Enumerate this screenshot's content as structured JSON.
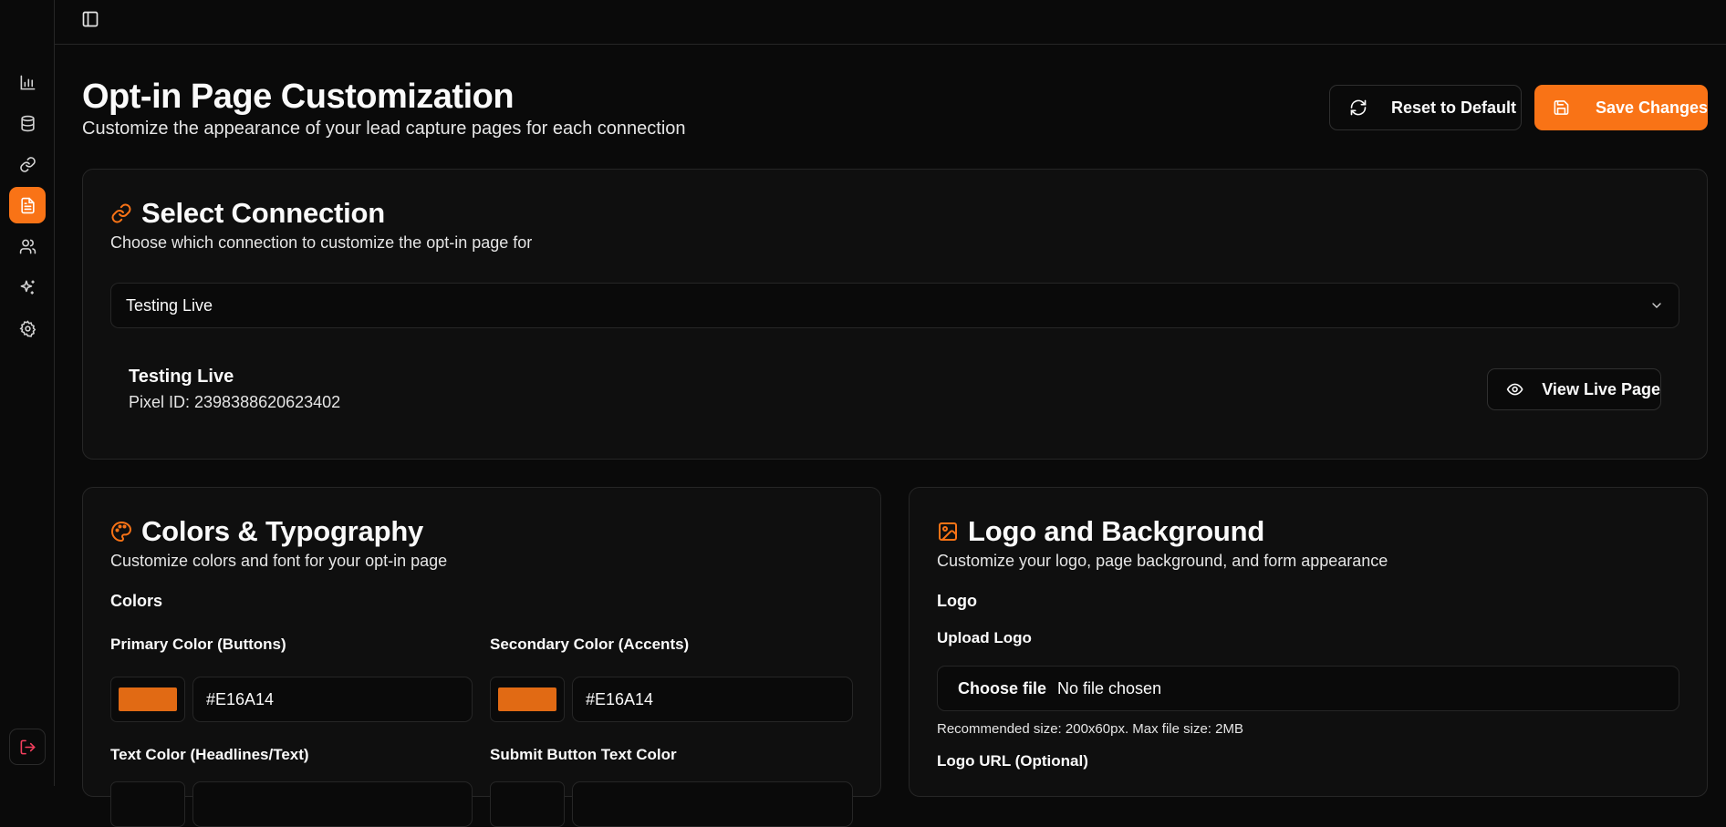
{
  "colors": {
    "accent": "#f97316",
    "background": "#0a0a0a",
    "card": "#0f0f0f",
    "border": "#262626",
    "logout": "#f43f5e"
  },
  "sidebar": {
    "items": [
      {
        "icon": "bar-chart-icon",
        "active": false
      },
      {
        "icon": "database-icon",
        "active": false
      },
      {
        "icon": "link-icon",
        "active": false
      },
      {
        "icon": "file-text-icon",
        "active": true
      },
      {
        "icon": "users-icon",
        "active": false
      },
      {
        "icon": "sparkles-icon",
        "active": false
      },
      {
        "icon": "gear-icon",
        "active": false
      }
    ],
    "logout_icon": "logout-icon"
  },
  "header": {
    "title": "Opt-in Page Customization",
    "subtitle": "Customize the appearance of your lead capture pages for each connection",
    "reset_label": "Reset to Default",
    "save_label": "Save Changes"
  },
  "select_connection": {
    "title": "Select Connection",
    "subtitle": "Choose which connection to customize the opt-in page for",
    "selected": "Testing Live",
    "connection_name": "Testing Live",
    "pixel_id": "Pixel ID: 2398388620623402",
    "view_live_label": "View Live Page"
  },
  "colors_typography": {
    "title": "Colors & Typography",
    "subtitle": "Customize colors and font for your opt-in page",
    "section_label": "Colors",
    "primary_label": "Primary Color (Buttons)",
    "primary_value": "#E16A14",
    "secondary_label": "Secondary Color (Accents)",
    "secondary_value": "#E16A14",
    "text_color_label": "Text Color (Headlines/Text)",
    "submit_text_label": "Submit Button Text Color"
  },
  "logo_background": {
    "title": "Logo and Background",
    "subtitle": "Customize your logo, page background, and form appearance",
    "section_label": "Logo",
    "upload_label": "Upload Logo",
    "choose_file": "Choose file",
    "no_file": "No file chosen",
    "hint": "Recommended size: 200x60px. Max file size: 2MB",
    "url_label": "Logo URL (Optional)"
  }
}
